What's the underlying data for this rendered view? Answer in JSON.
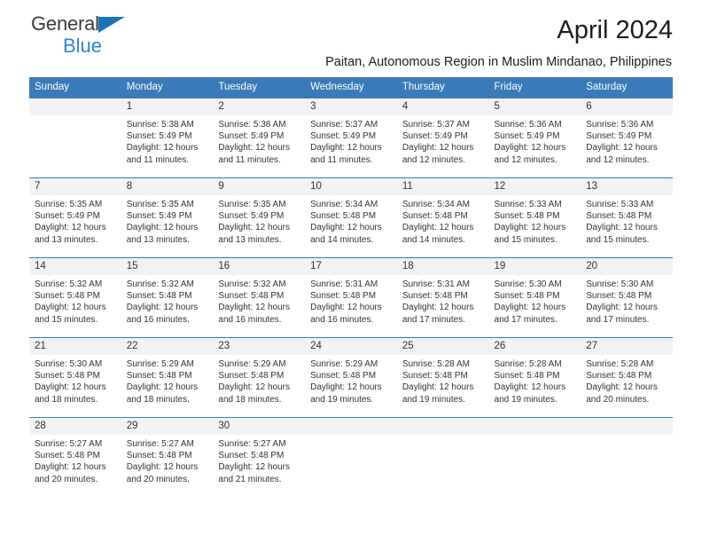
{
  "brand": {
    "name_part1": "General",
    "name_part2": "Blue",
    "triangle_color": "#1a72ba",
    "blue_text_color": "#2f87d6"
  },
  "header": {
    "month_title": "April 2024",
    "subtitle": "Paitan, Autonomous Region in Muslim Mindanao, Philippines",
    "header_bg_color": "#3b7ab8",
    "daynum_bg_color": "#f2f2f2"
  },
  "weekday_headers": [
    "Sunday",
    "Monday",
    "Tuesday",
    "Wednesday",
    "Thursday",
    "Friday",
    "Saturday"
  ],
  "labels": {
    "sunrise_prefix": "Sunrise:",
    "sunset_prefix": "Sunset:",
    "daylight_prefix": "Daylight:"
  },
  "weeks": [
    [
      {
        "day": "",
        "sunrise": "",
        "sunset": "",
        "daylight_line1": "",
        "daylight_line2": ""
      },
      {
        "day": "1",
        "sunrise": "Sunrise: 5:38 AM",
        "sunset": "Sunset: 5:49 PM",
        "daylight_line1": "Daylight: 12 hours",
        "daylight_line2": "and 11 minutes."
      },
      {
        "day": "2",
        "sunrise": "Sunrise: 5:38 AM",
        "sunset": "Sunset: 5:49 PM",
        "daylight_line1": "Daylight: 12 hours",
        "daylight_line2": "and 11 minutes."
      },
      {
        "day": "3",
        "sunrise": "Sunrise: 5:37 AM",
        "sunset": "Sunset: 5:49 PM",
        "daylight_line1": "Daylight: 12 hours",
        "daylight_line2": "and 11 minutes."
      },
      {
        "day": "4",
        "sunrise": "Sunrise: 5:37 AM",
        "sunset": "Sunset: 5:49 PM",
        "daylight_line1": "Daylight: 12 hours",
        "daylight_line2": "and 12 minutes."
      },
      {
        "day": "5",
        "sunrise": "Sunrise: 5:36 AM",
        "sunset": "Sunset: 5:49 PM",
        "daylight_line1": "Daylight: 12 hours",
        "daylight_line2": "and 12 minutes."
      },
      {
        "day": "6",
        "sunrise": "Sunrise: 5:36 AM",
        "sunset": "Sunset: 5:49 PM",
        "daylight_line1": "Daylight: 12 hours",
        "daylight_line2": "and 12 minutes."
      }
    ],
    [
      {
        "day": "7",
        "sunrise": "Sunrise: 5:35 AM",
        "sunset": "Sunset: 5:49 PM",
        "daylight_line1": "Daylight: 12 hours",
        "daylight_line2": "and 13 minutes."
      },
      {
        "day": "8",
        "sunrise": "Sunrise: 5:35 AM",
        "sunset": "Sunset: 5:49 PM",
        "daylight_line1": "Daylight: 12 hours",
        "daylight_line2": "and 13 minutes."
      },
      {
        "day": "9",
        "sunrise": "Sunrise: 5:35 AM",
        "sunset": "Sunset: 5:49 PM",
        "daylight_line1": "Daylight: 12 hours",
        "daylight_line2": "and 13 minutes."
      },
      {
        "day": "10",
        "sunrise": "Sunrise: 5:34 AM",
        "sunset": "Sunset: 5:48 PM",
        "daylight_line1": "Daylight: 12 hours",
        "daylight_line2": "and 14 minutes."
      },
      {
        "day": "11",
        "sunrise": "Sunrise: 5:34 AM",
        "sunset": "Sunset: 5:48 PM",
        "daylight_line1": "Daylight: 12 hours",
        "daylight_line2": "and 14 minutes."
      },
      {
        "day": "12",
        "sunrise": "Sunrise: 5:33 AM",
        "sunset": "Sunset: 5:48 PM",
        "daylight_line1": "Daylight: 12 hours",
        "daylight_line2": "and 15 minutes."
      },
      {
        "day": "13",
        "sunrise": "Sunrise: 5:33 AM",
        "sunset": "Sunset: 5:48 PM",
        "daylight_line1": "Daylight: 12 hours",
        "daylight_line2": "and 15 minutes."
      }
    ],
    [
      {
        "day": "14",
        "sunrise": "Sunrise: 5:32 AM",
        "sunset": "Sunset: 5:48 PM",
        "daylight_line1": "Daylight: 12 hours",
        "daylight_line2": "and 15 minutes."
      },
      {
        "day": "15",
        "sunrise": "Sunrise: 5:32 AM",
        "sunset": "Sunset: 5:48 PM",
        "daylight_line1": "Daylight: 12 hours",
        "daylight_line2": "and 16 minutes."
      },
      {
        "day": "16",
        "sunrise": "Sunrise: 5:32 AM",
        "sunset": "Sunset: 5:48 PM",
        "daylight_line1": "Daylight: 12 hours",
        "daylight_line2": "and 16 minutes."
      },
      {
        "day": "17",
        "sunrise": "Sunrise: 5:31 AM",
        "sunset": "Sunset: 5:48 PM",
        "daylight_line1": "Daylight: 12 hours",
        "daylight_line2": "and 16 minutes."
      },
      {
        "day": "18",
        "sunrise": "Sunrise: 5:31 AM",
        "sunset": "Sunset: 5:48 PM",
        "daylight_line1": "Daylight: 12 hours",
        "daylight_line2": "and 17 minutes."
      },
      {
        "day": "19",
        "sunrise": "Sunrise: 5:30 AM",
        "sunset": "Sunset: 5:48 PM",
        "daylight_line1": "Daylight: 12 hours",
        "daylight_line2": "and 17 minutes."
      },
      {
        "day": "20",
        "sunrise": "Sunrise: 5:30 AM",
        "sunset": "Sunset: 5:48 PM",
        "daylight_line1": "Daylight: 12 hours",
        "daylight_line2": "and 17 minutes."
      }
    ],
    [
      {
        "day": "21",
        "sunrise": "Sunrise: 5:30 AM",
        "sunset": "Sunset: 5:48 PM",
        "daylight_line1": "Daylight: 12 hours",
        "daylight_line2": "and 18 minutes."
      },
      {
        "day": "22",
        "sunrise": "Sunrise: 5:29 AM",
        "sunset": "Sunset: 5:48 PM",
        "daylight_line1": "Daylight: 12 hours",
        "daylight_line2": "and 18 minutes."
      },
      {
        "day": "23",
        "sunrise": "Sunrise: 5:29 AM",
        "sunset": "Sunset: 5:48 PM",
        "daylight_line1": "Daylight: 12 hours",
        "daylight_line2": "and 18 minutes."
      },
      {
        "day": "24",
        "sunrise": "Sunrise: 5:29 AM",
        "sunset": "Sunset: 5:48 PM",
        "daylight_line1": "Daylight: 12 hours",
        "daylight_line2": "and 19 minutes."
      },
      {
        "day": "25",
        "sunrise": "Sunrise: 5:28 AM",
        "sunset": "Sunset: 5:48 PM",
        "daylight_line1": "Daylight: 12 hours",
        "daylight_line2": "and 19 minutes."
      },
      {
        "day": "26",
        "sunrise": "Sunrise: 5:28 AM",
        "sunset": "Sunset: 5:48 PM",
        "daylight_line1": "Daylight: 12 hours",
        "daylight_line2": "and 19 minutes."
      },
      {
        "day": "27",
        "sunrise": "Sunrise: 5:28 AM",
        "sunset": "Sunset: 5:48 PM",
        "daylight_line1": "Daylight: 12 hours",
        "daylight_line2": "and 20 minutes."
      }
    ],
    [
      {
        "day": "28",
        "sunrise": "Sunrise: 5:27 AM",
        "sunset": "Sunset: 5:48 PM",
        "daylight_line1": "Daylight: 12 hours",
        "daylight_line2": "and 20 minutes."
      },
      {
        "day": "29",
        "sunrise": "Sunrise: 5:27 AM",
        "sunset": "Sunset: 5:48 PM",
        "daylight_line1": "Daylight: 12 hours",
        "daylight_line2": "and 20 minutes."
      },
      {
        "day": "30",
        "sunrise": "Sunrise: 5:27 AM",
        "sunset": "Sunset: 5:48 PM",
        "daylight_line1": "Daylight: 12 hours",
        "daylight_line2": "and 21 minutes."
      },
      {
        "day": "",
        "sunrise": "",
        "sunset": "",
        "daylight_line1": "",
        "daylight_line2": ""
      },
      {
        "day": "",
        "sunrise": "",
        "sunset": "",
        "daylight_line1": "",
        "daylight_line2": ""
      },
      {
        "day": "",
        "sunrise": "",
        "sunset": "",
        "daylight_line1": "",
        "daylight_line2": ""
      },
      {
        "day": "",
        "sunrise": "",
        "sunset": "",
        "daylight_line1": "",
        "daylight_line2": ""
      }
    ]
  ]
}
